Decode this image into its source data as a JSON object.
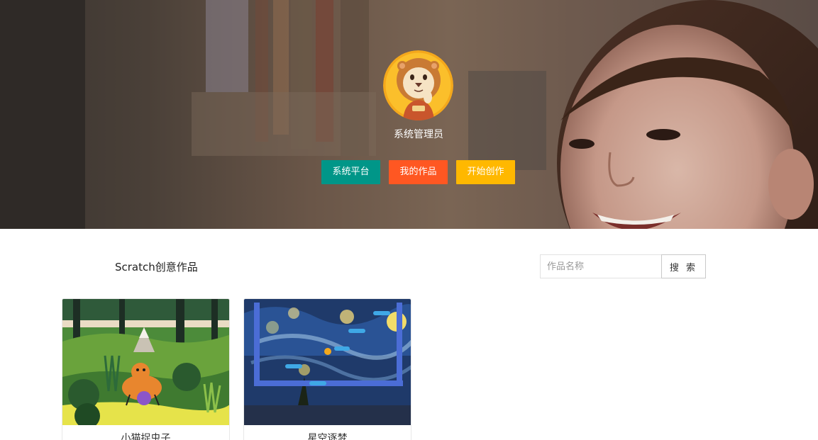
{
  "hero": {
    "username": "系统管理员",
    "buttons": {
      "platform": "系统平台",
      "my_works": "我的作品",
      "create": "开始创作"
    },
    "colors": {
      "platform": "#009688",
      "my_works": "#ff5722",
      "create": "#ffb800"
    },
    "avatar_icon": "lion-avatar-icon"
  },
  "section": {
    "title": "Scratch创意作品"
  },
  "search": {
    "placeholder": "作品名称",
    "value": "",
    "button_label": "搜 索"
  },
  "works": [
    {
      "title": "小猫捉虫子",
      "thumb_icon": "jungle-cat-thumbnail"
    },
    {
      "title": "星空逐梦",
      "thumb_icon": "starry-night-thumbnail"
    }
  ]
}
